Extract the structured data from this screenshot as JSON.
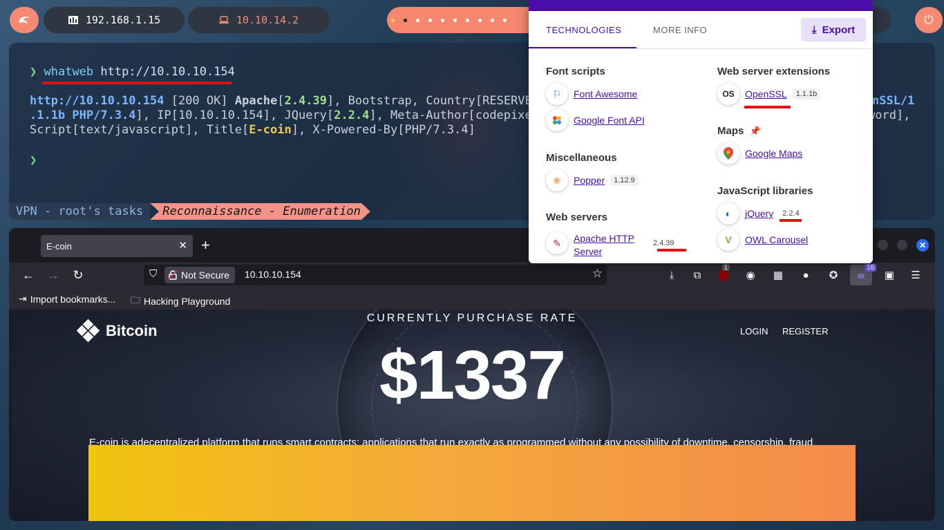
{
  "topbar": {
    "ip_local": "192.168.1.15",
    "ip_vpn": "10.10.14.2",
    "colors": {
      "accent": "#f58a74",
      "pill": "#2e3642",
      "vpn_text": "#f48c7a"
    }
  },
  "terminal": {
    "prompt": "❯",
    "command": "whatweb",
    "command_arg": "http://10.10.10.154",
    "line1": {
      "url": "http://10.10.10.154",
      "status": "[200 OK]",
      "apache": "Apache",
      "apache_ver": "2.4.39",
      "rest": ", Bootstrap, Country[RESERVED",
      "tail": "nSSL/1"
    },
    "line2": {
      "a": ".1.1b PHP/7.3.4",
      "b": "], IP[",
      "ip": "10.10.10.154",
      "c": "], JQuery[",
      "jq": "2.2.4",
      "d": "], Meta-Author[codepixer",
      "tail": "word],"
    },
    "line3": {
      "a": " Script[text/javascript], Title[",
      "title": "E-coin",
      "b": "], X-Powered-By[",
      "php": "PHP/7.3.4",
      "c": "]"
    },
    "prompt2": "❯",
    "status_vpn": "VPN - root's tasks",
    "status_task": "Reconnaissance - Enumeration"
  },
  "browser": {
    "tab_title": "E-coin",
    "not_secure": "Not Secure",
    "url": "10.10.10.154",
    "ext_badge_ublock": "1",
    "ext_badge_wappalyzer": "16",
    "bookmarks": [
      {
        "label": "Import bookmarks..."
      },
      {
        "label": "Hacking Playground"
      }
    ]
  },
  "site": {
    "brand": "Bitcoin",
    "purchase_rate_label": "CURRENTLY PURCHASE RATE",
    "nav_login": "LOGIN",
    "nav_register": "REGISTER",
    "price": "$1337",
    "description": "E-coin is adecentralized platform that runs smart contracts: applications that run exactly as programmed without any possibility of downtime, censorship, fraud"
  },
  "wappalyzer": {
    "tab_technologies": "TECHNOLOGIES",
    "tab_more_info": "MORE INFO",
    "export_label": "Export",
    "categories": {
      "font_scripts": "Font scripts",
      "web_server_ext": "Web server extensions",
      "maps": "Maps",
      "misc": "Miscellaneous",
      "js_libs": "JavaScript libraries",
      "web_servers": "Web servers"
    },
    "techs": {
      "font_awesome": {
        "name": "Font Awesome"
      },
      "google_font_api": {
        "name": "Google Font API"
      },
      "openssl": {
        "name": "OpenSSL",
        "version": "1.1.1b"
      },
      "google_maps": {
        "name": "Google Maps"
      },
      "popper": {
        "name": "Popper",
        "version": "1.12.9"
      },
      "jquery": {
        "name": "jQuery",
        "version": "2.2.4"
      },
      "apache": {
        "name_1": "Apache HTTP",
        "name_2": "Server",
        "version": "2.4.39"
      },
      "owl": {
        "name": "OWL Carousel"
      }
    },
    "colors": {
      "brand": "#4a0fa8",
      "highlight": "#e01010"
    }
  }
}
